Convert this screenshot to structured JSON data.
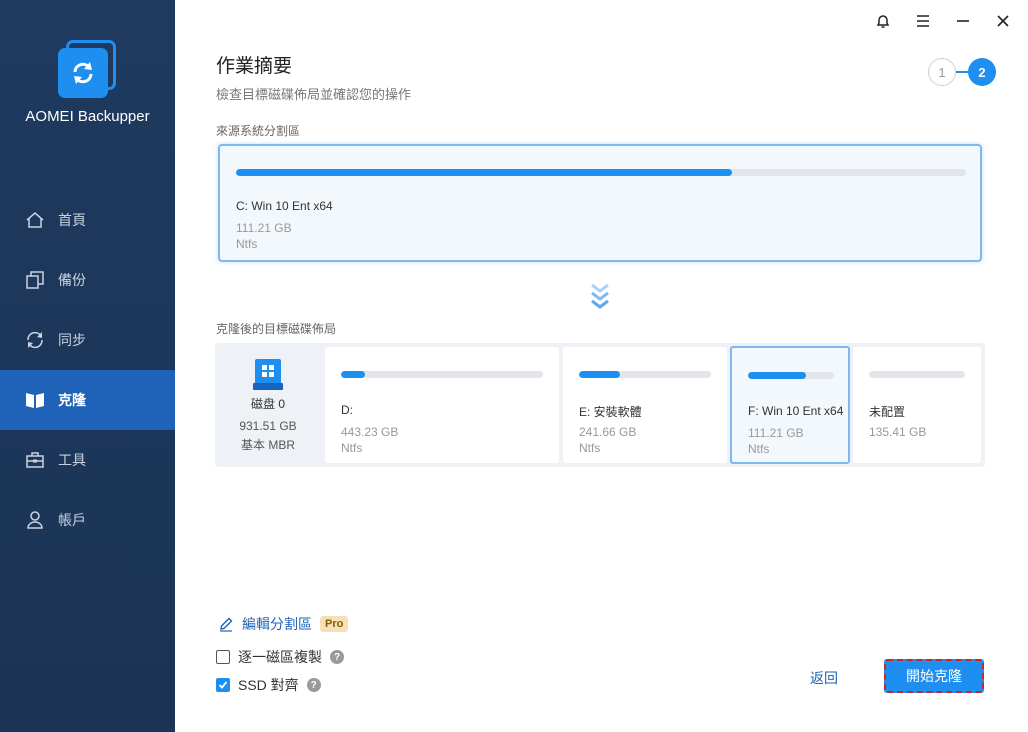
{
  "app": {
    "name": "AOMEI Backupper"
  },
  "sidebar": {
    "items": [
      {
        "label": "首頁",
        "icon": "home-icon"
      },
      {
        "label": "備份",
        "icon": "backup-icon"
      },
      {
        "label": "同步",
        "icon": "sync-icon"
      },
      {
        "label": "克隆",
        "icon": "clone-icon",
        "active": true
      },
      {
        "label": "工具",
        "icon": "toolbox-icon"
      },
      {
        "label": "帳戶",
        "icon": "user-icon"
      }
    ]
  },
  "window": {
    "controls": [
      "bell-icon",
      "menu-icon",
      "minimize-icon",
      "close-icon"
    ]
  },
  "header": {
    "title": "作業摘要",
    "subtitle": "檢查目標磁碟佈局並確認您的操作",
    "steps": [
      "1",
      "2"
    ],
    "current_step": 2
  },
  "source": {
    "label": "來源系統分割區",
    "partition": {
      "name": "C: Win 10 Ent x64",
      "size": "111.21 GB",
      "fs": "Ntfs",
      "used_fraction": 0.68
    }
  },
  "destination": {
    "label": "克隆後的目標磁碟佈局",
    "disk": {
      "name": "磁盘 0",
      "size": "931.51 GB",
      "type": "基本 MBR"
    },
    "partitions": [
      {
        "name": "D:",
        "size": "443.23 GB",
        "fs": "Ntfs",
        "used_fraction": 0.12
      },
      {
        "name": "E: 安裝軟體",
        "size": "241.66 GB",
        "fs": "Ntfs",
        "used_fraction": 0.31
      },
      {
        "name": "F: Win 10 Ent x64",
        "size": "111.21 GB",
        "fs": "Ntfs",
        "used_fraction": 0.68,
        "selected": true
      },
      {
        "name": "未配置",
        "size": "135.41 GB",
        "fs": "",
        "used_fraction": 0
      }
    ]
  },
  "options": {
    "edit_label": "編輯分割區",
    "pro_badge": "Pro",
    "sector_by_sector": {
      "label": "逐一磁區複製",
      "checked": false
    },
    "ssd_align": {
      "label": "SSD 對齊",
      "checked": true
    },
    "help": "?"
  },
  "footer": {
    "back_label": "返回",
    "start_label": "開始克隆"
  },
  "colors": {
    "accent": "#1e8ff0",
    "sidebar_bg": "#1f3a5f",
    "sidebar_active": "#1e63b8"
  }
}
